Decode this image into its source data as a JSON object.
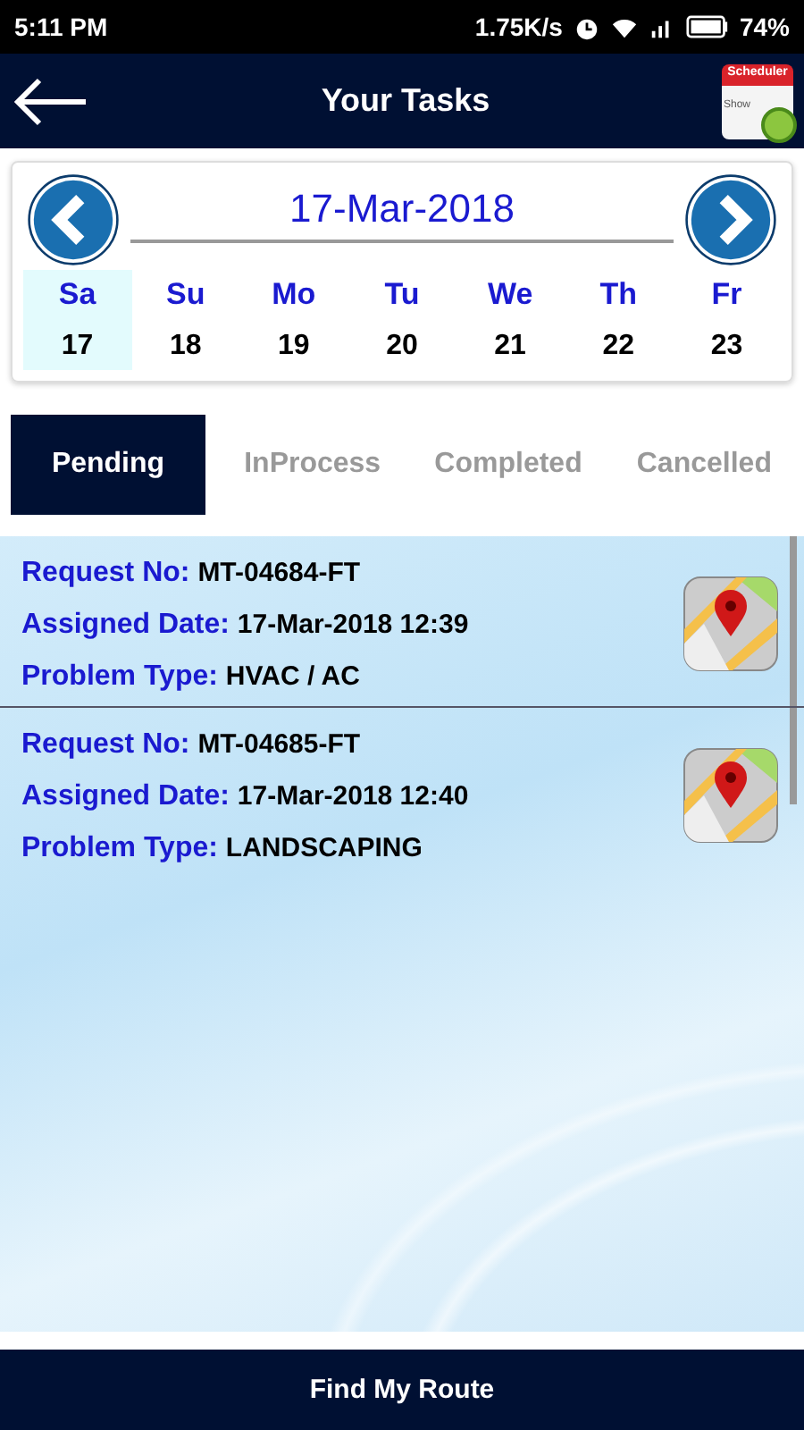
{
  "status_bar": {
    "time": "5:11 PM",
    "speed": "1.75K/s",
    "battery": "74%"
  },
  "header": {
    "title": "Your Tasks",
    "app_icon_label": "Scheduler",
    "app_icon_sublabel": "Show"
  },
  "calendar": {
    "date": "17-Mar-2018",
    "days": [
      {
        "weekday": "Sa",
        "day": "17",
        "selected": true
      },
      {
        "weekday": "Su",
        "day": "18",
        "selected": false
      },
      {
        "weekday": "Mo",
        "day": "19",
        "selected": false
      },
      {
        "weekday": "Tu",
        "day": "20",
        "selected": false
      },
      {
        "weekday": "We",
        "day": "21",
        "selected": false
      },
      {
        "weekday": "Th",
        "day": "22",
        "selected": false
      },
      {
        "weekday": "Fr",
        "day": "23",
        "selected": false
      }
    ]
  },
  "tabs": [
    {
      "label": "Pending",
      "selected": true
    },
    {
      "label": "InProcess",
      "selected": false
    },
    {
      "label": "Completed",
      "selected": false
    },
    {
      "label": "Cancelled",
      "selected": false
    }
  ],
  "tasks": [
    {
      "fields": [
        {
          "label": "Request No:",
          "value": "MT-04684-FT"
        },
        {
          "label": "Assigned Date:",
          "value": "17-Mar-2018 12:39"
        },
        {
          "label": "Problem Type:",
          "value": "HVAC / AC"
        }
      ]
    },
    {
      "fields": [
        {
          "label": "Request No:",
          "value": "MT-04685-FT"
        },
        {
          "label": "Assigned Date:",
          "value": "17-Mar-2018 12:40"
        },
        {
          "label": "Problem Type:",
          "value": "LANDSCAPING"
        }
      ]
    }
  ],
  "footer_button": "Find My Route"
}
